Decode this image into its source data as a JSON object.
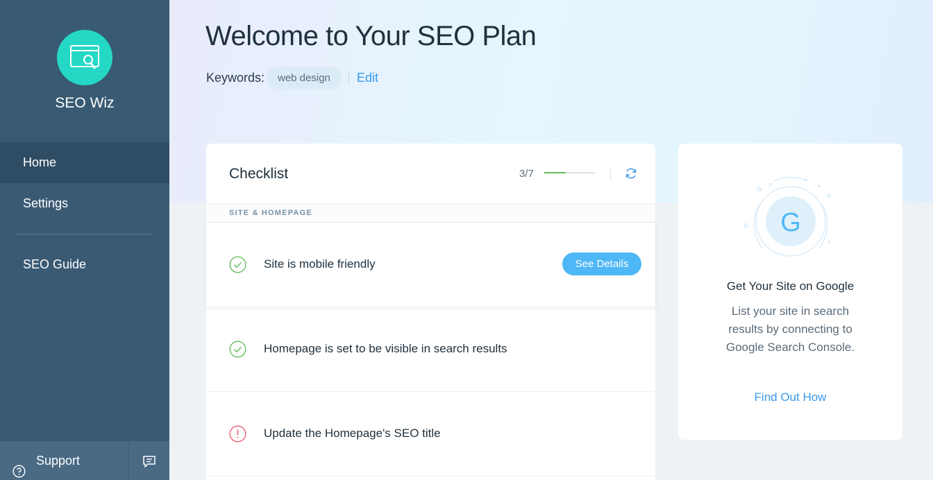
{
  "app": {
    "name": "SEO Wiz",
    "logo_icon": "seo-magnifier-icon"
  },
  "sidebar": {
    "items": [
      {
        "label": "Home",
        "active": true
      },
      {
        "label": "Settings",
        "active": false
      },
      {
        "label": "SEO Guide",
        "active": false
      }
    ],
    "support_label": "Support",
    "support_icon": "help-circle-icon",
    "chat_icon": "chat-icon"
  },
  "header": {
    "title": "Welcome to Your SEO Plan",
    "keywords_label": "Keywords:",
    "keywords": [
      "web design"
    ],
    "edit_label": "Edit"
  },
  "checklist": {
    "title": "Checklist",
    "progress_text": "3/7",
    "progress_fraction": 0.43,
    "section_label": "SITE & HOMEPAGE",
    "items": [
      {
        "text": "Site is mobile friendly",
        "status": "done",
        "button": "See Details"
      },
      {
        "text": "Homepage is set to be visible in search results",
        "status": "done"
      },
      {
        "text": "Update the Homepage's SEO title",
        "status": "warning"
      }
    ]
  },
  "google_card": {
    "title": "Get Your Site on Google",
    "description": "List your site in search results by connecting to Google Search Console.",
    "link": "Find Out How",
    "icon": "google-g-icon"
  },
  "colors": {
    "sidebar": "#3a5a74",
    "accent": "#3899ec",
    "teal": "#25d8c6",
    "success": "#60bc57",
    "warning": "#ee5a6f"
  }
}
